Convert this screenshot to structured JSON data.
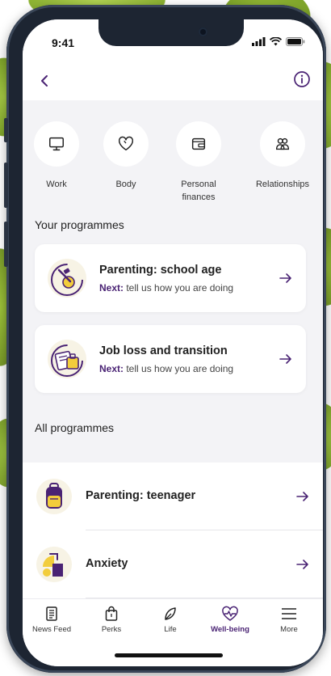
{
  "status": {
    "time": "9:41"
  },
  "categories": [
    {
      "label": "Work",
      "icon": "monitor-icon"
    },
    {
      "label": "Body",
      "icon": "heart-icon"
    },
    {
      "label": "Personal\nfinances",
      "icon": "wallet-icon"
    },
    {
      "label": "Relationships",
      "icon": "people-icon"
    }
  ],
  "your_programmes": {
    "title": "Your programmes",
    "items": [
      {
        "title": "Parenting: school age",
        "next_label": "Next:",
        "next_text": " tell us how you are doing"
      },
      {
        "title": "Job loss and transition",
        "next_label": "Next:",
        "next_text": " tell us how you are doing"
      }
    ]
  },
  "all_programmes": {
    "title": "All programmes",
    "items": [
      {
        "title": "Parenting: teenager"
      },
      {
        "title": "Anxiety"
      }
    ]
  },
  "tabs": [
    {
      "label": "News Feed",
      "icon": "news-icon"
    },
    {
      "label": "Perks",
      "icon": "bag-icon"
    },
    {
      "label": "Life",
      "icon": "leaf-icon"
    },
    {
      "label": "Well-being",
      "icon": "heartbeat-icon",
      "active": true
    },
    {
      "label": "More",
      "icon": "menu-icon"
    }
  ],
  "colors": {
    "accent": "#4a2374",
    "highlight": "#f2cd3c",
    "background": "#f3f3f6"
  }
}
